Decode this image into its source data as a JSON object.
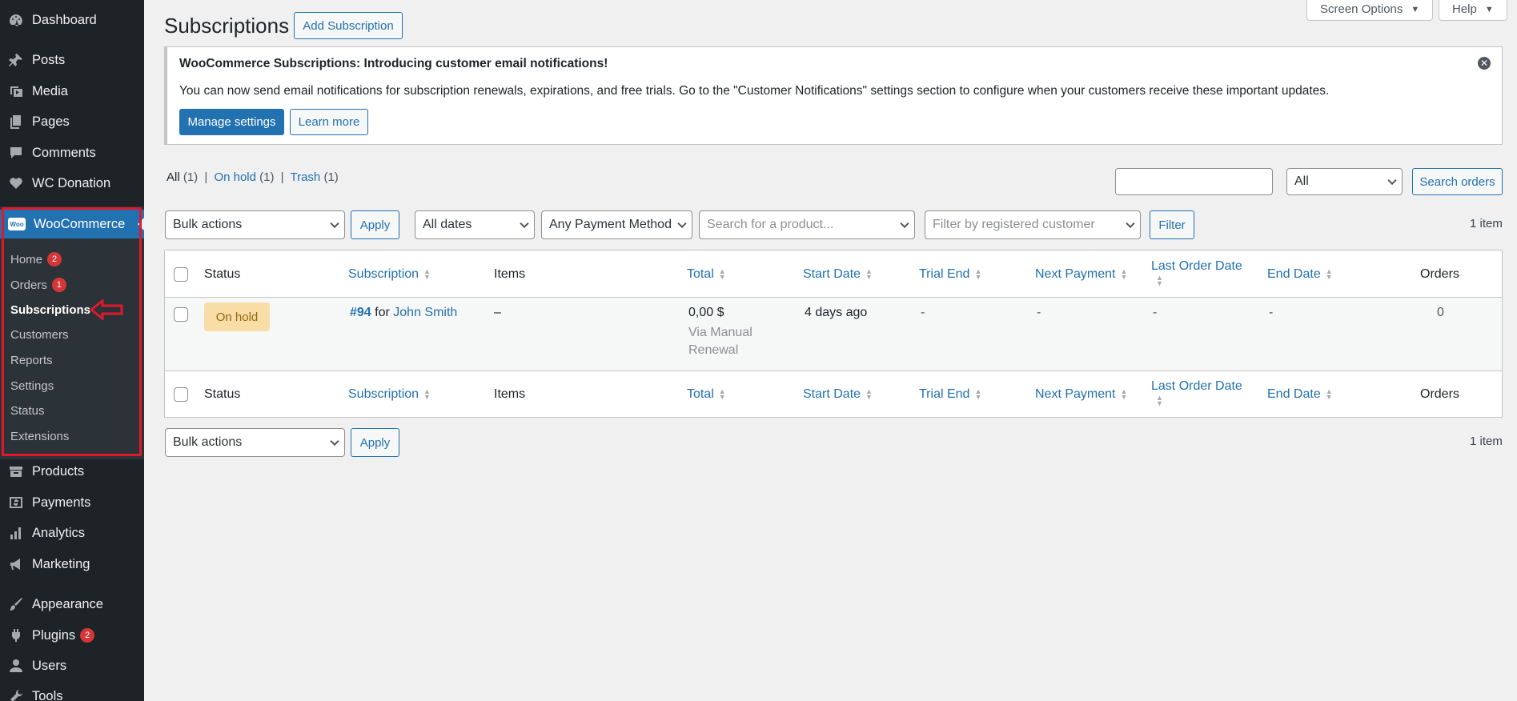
{
  "sidebar": {
    "items_top": [
      {
        "label": "Dashboard",
        "icon": "dashboard-icon"
      },
      {
        "label": "Posts",
        "icon": "pin-icon"
      },
      {
        "label": "Media",
        "icon": "media-icon"
      },
      {
        "label": "Pages",
        "icon": "pages-icon"
      },
      {
        "label": "Comments",
        "icon": "comment-icon"
      },
      {
        "label": "WC Donation",
        "icon": "heart-icon"
      }
    ],
    "woocommerce": {
      "label": "WooCommerce",
      "logo_text": "Woo",
      "submenu": [
        {
          "label": "Home",
          "badge": "2"
        },
        {
          "label": "Orders",
          "badge": "1"
        },
        {
          "label": "Subscriptions"
        },
        {
          "label": "Customers"
        },
        {
          "label": "Reports"
        },
        {
          "label": "Settings"
        },
        {
          "label": "Status"
        },
        {
          "label": "Extensions"
        }
      ]
    },
    "items_bottom": [
      {
        "label": "Products",
        "icon": "archive-icon"
      },
      {
        "label": "Payments",
        "icon": "payment-icon"
      },
      {
        "label": "Analytics",
        "icon": "bar-chart-icon"
      },
      {
        "label": "Marketing",
        "icon": "megaphone-icon"
      },
      {
        "label": "Appearance",
        "icon": "brush-icon"
      },
      {
        "label": "Plugins",
        "icon": "plug-icon",
        "badge": "2"
      },
      {
        "label": "Users",
        "icon": "user-icon"
      },
      {
        "label": "Tools",
        "icon": "wrench-icon"
      }
    ]
  },
  "header": {
    "title": "Subscriptions",
    "add_button": "Add Subscription",
    "screen_options": "Screen Options",
    "help": "Help"
  },
  "notice": {
    "title": "WooCommerce Subscriptions: Introducing customer email notifications!",
    "text": "You can now send email notifications for subscription renewals, expirations, and free trials. Go to the \"Customer Notifications\" settings section to configure when your customers receive these important updates.",
    "manage_button": "Manage settings",
    "learn_button": "Learn more"
  },
  "views": {
    "all": "All",
    "all_count": "(1)",
    "on_hold": "On hold",
    "on_hold_count": "(1)",
    "trash": "Trash",
    "trash_count": "(1)",
    "sep": "|"
  },
  "search": {
    "value": "",
    "type_select": "All",
    "button": "Search orders"
  },
  "filters": {
    "bulk_actions": "Bulk actions",
    "apply": "Apply",
    "dates": "All dates",
    "payment_method": "Any Payment Method",
    "product_placeholder": "Search for a product...",
    "customer_placeholder": "Filter by registered customer",
    "filter_button": "Filter",
    "items_count": "1 item"
  },
  "table": {
    "columns": {
      "status": "Status",
      "subscription": "Subscription",
      "items": "Items",
      "total": "Total",
      "start_date": "Start Date",
      "trial_end": "Trial End",
      "next_payment": "Next Payment",
      "last_order_date": "Last Order Date",
      "end_date": "End Date",
      "orders": "Orders"
    },
    "row": {
      "status": "On hold",
      "number": "#94",
      "for": "for",
      "customer": "John Smith",
      "items": "–",
      "total": "0,00 $",
      "total_via_1": "Via Manual",
      "total_via_2": "Renewal",
      "start_date": "4 days ago",
      "trial_end": "-",
      "next_payment": "-",
      "last_order_date": "-",
      "end_date": "-",
      "orders": "0"
    }
  },
  "colors": {
    "sidebar_bg": "#1d2327",
    "accent": "#2271b1",
    "highlight": "#e0182a",
    "on_hold_bg": "#f8dda7"
  }
}
